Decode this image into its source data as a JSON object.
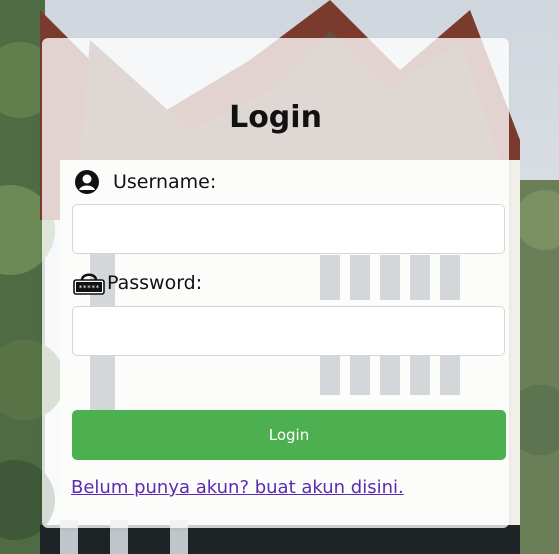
{
  "login": {
    "title": "Login",
    "username_label": "Username:",
    "password_label": "Password:",
    "username_value": "",
    "password_value": "",
    "button_label": "Login",
    "register_link": "Belum punya akun? buat akun disini."
  },
  "icons": {
    "username": "user-circle-icon",
    "password": "keyboard-password-icon"
  },
  "colors": {
    "button": "#4caf50",
    "link": "#5b2bb0"
  }
}
